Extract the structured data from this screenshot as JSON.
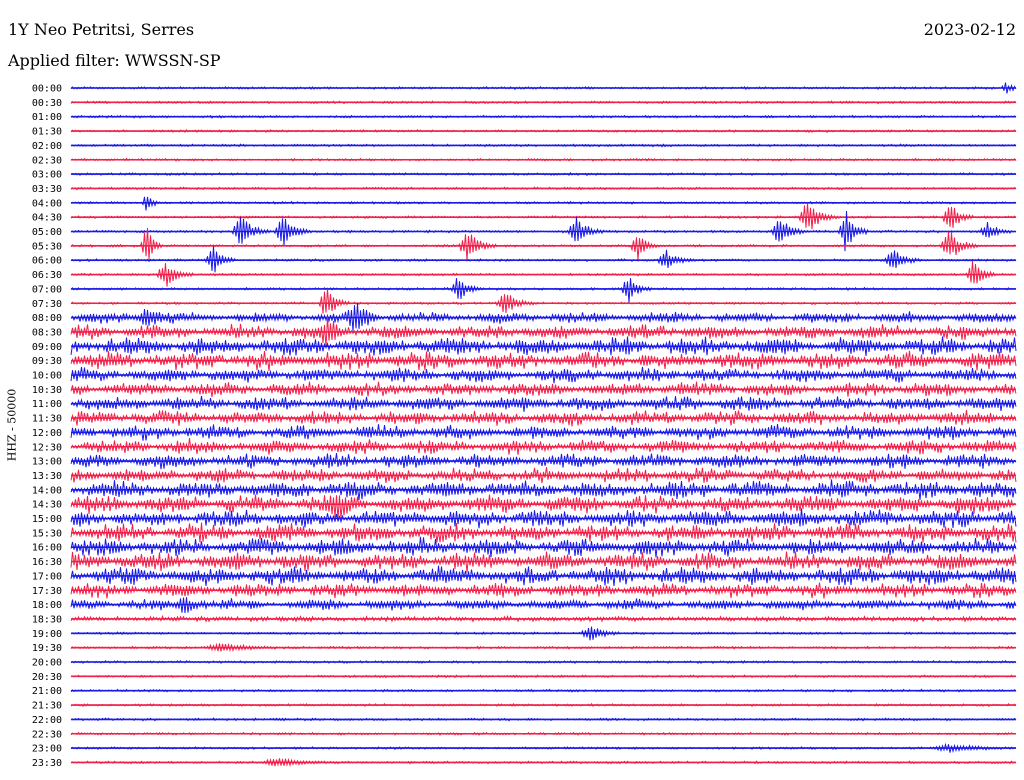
{
  "header": {
    "station": "1Y Neo Petritsi, Serres",
    "date": "2023-02-12",
    "filter": "Applied filter: WWSSN-SP"
  },
  "chart_data": {
    "type": "line",
    "title": "1Y Neo Petritsi, Serres",
    "ylabel": "HHZ - 50000",
    "row_labels": [
      "00:00",
      "00:30",
      "01:00",
      "01:30",
      "02:00",
      "02:30",
      "03:00",
      "03:30",
      "04:00",
      "04:30",
      "05:00",
      "05:30",
      "06:00",
      "06:30",
      "07:00",
      "07:30",
      "08:00",
      "08:30",
      "09:00",
      "09:30",
      "10:00",
      "10:30",
      "11:00",
      "11:30",
      "12:00",
      "12:30",
      "13:00",
      "13:30",
      "14:00",
      "14:30",
      "15:00",
      "15:30",
      "16:00",
      "16:30",
      "17:00",
      "17:30",
      "18:00",
      "18:30",
      "19:00",
      "19:30",
      "20:00",
      "20:30",
      "21:00",
      "21:30",
      "22:00",
      "22:30",
      "23:00",
      "23:30"
    ],
    "colors": [
      "#1a1ae6",
      "#f0204a"
    ],
    "noise_level": [
      1,
      1,
      1,
      1,
      1,
      1,
      1,
      1,
      1,
      1,
      1,
      1,
      1,
      1,
      1,
      1,
      3,
      4,
      5,
      5,
      4,
      4,
      4,
      4,
      4,
      4,
      4,
      4,
      5,
      5,
      5,
      5,
      5,
      5,
      5,
      4,
      3,
      2,
      1,
      1,
      1,
      1,
      1,
      1,
      1,
      1,
      1,
      1
    ],
    "events": [
      {
        "row": 0,
        "x": 0.99,
        "amp": 6,
        "w": 0.006
      },
      {
        "row": 8,
        "x": 0.08,
        "amp": 14,
        "w": 0.004
      },
      {
        "row": 9,
        "x": 0.78,
        "amp": 18,
        "w": 0.01
      },
      {
        "row": 9,
        "x": 0.93,
        "amp": 16,
        "w": 0.008
      },
      {
        "row": 10,
        "x": 0.18,
        "amp": 18,
        "w": 0.01
      },
      {
        "row": 10,
        "x": 0.225,
        "amp": 16,
        "w": 0.01
      },
      {
        "row": 10,
        "x": 0.535,
        "amp": 14,
        "w": 0.01
      },
      {
        "row": 10,
        "x": 0.75,
        "amp": 14,
        "w": 0.01
      },
      {
        "row": 10,
        "x": 0.82,
        "amp": 22,
        "w": 0.008
      },
      {
        "row": 10,
        "x": 0.97,
        "amp": 10,
        "w": 0.008
      },
      {
        "row": 11,
        "x": 0.08,
        "amp": 20,
        "w": 0.006
      },
      {
        "row": 11,
        "x": 0.42,
        "amp": 16,
        "w": 0.01
      },
      {
        "row": 11,
        "x": 0.6,
        "amp": 14,
        "w": 0.008
      },
      {
        "row": 11,
        "x": 0.93,
        "amp": 16,
        "w": 0.01
      },
      {
        "row": 12,
        "x": 0.15,
        "amp": 16,
        "w": 0.008
      },
      {
        "row": 12,
        "x": 0.63,
        "amp": 10,
        "w": 0.01
      },
      {
        "row": 12,
        "x": 0.87,
        "amp": 12,
        "w": 0.01
      },
      {
        "row": 13,
        "x": 0.1,
        "amp": 14,
        "w": 0.01
      },
      {
        "row": 13,
        "x": 0.955,
        "amp": 18,
        "w": 0.008
      },
      {
        "row": 14,
        "x": 0.41,
        "amp": 14,
        "w": 0.008
      },
      {
        "row": 14,
        "x": 0.59,
        "amp": 14,
        "w": 0.008
      },
      {
        "row": 15,
        "x": 0.27,
        "amp": 18,
        "w": 0.008
      },
      {
        "row": 15,
        "x": 0.46,
        "amp": 12,
        "w": 0.01
      },
      {
        "row": 16,
        "x": 0.3,
        "amp": 16,
        "w": 0.01
      },
      {
        "row": 16,
        "x": 0.08,
        "amp": 10,
        "w": 0.01
      },
      {
        "row": 17,
        "x": 0.27,
        "amp": 14,
        "w": 0.008
      },
      {
        "row": 29,
        "x": 0.28,
        "amp": 10,
        "w": 0.01
      },
      {
        "row": 36,
        "x": 0.12,
        "amp": 10,
        "w": 0.008
      },
      {
        "row": 38,
        "x": 0.55,
        "amp": 10,
        "w": 0.01
      },
      {
        "row": 39,
        "x": 0.16,
        "amp": 4,
        "w": 0.02
      },
      {
        "row": 46,
        "x": 0.93,
        "amp": 4,
        "w": 0.02
      },
      {
        "row": 47,
        "x": 0.22,
        "amp": 4,
        "w": 0.02
      }
    ]
  }
}
